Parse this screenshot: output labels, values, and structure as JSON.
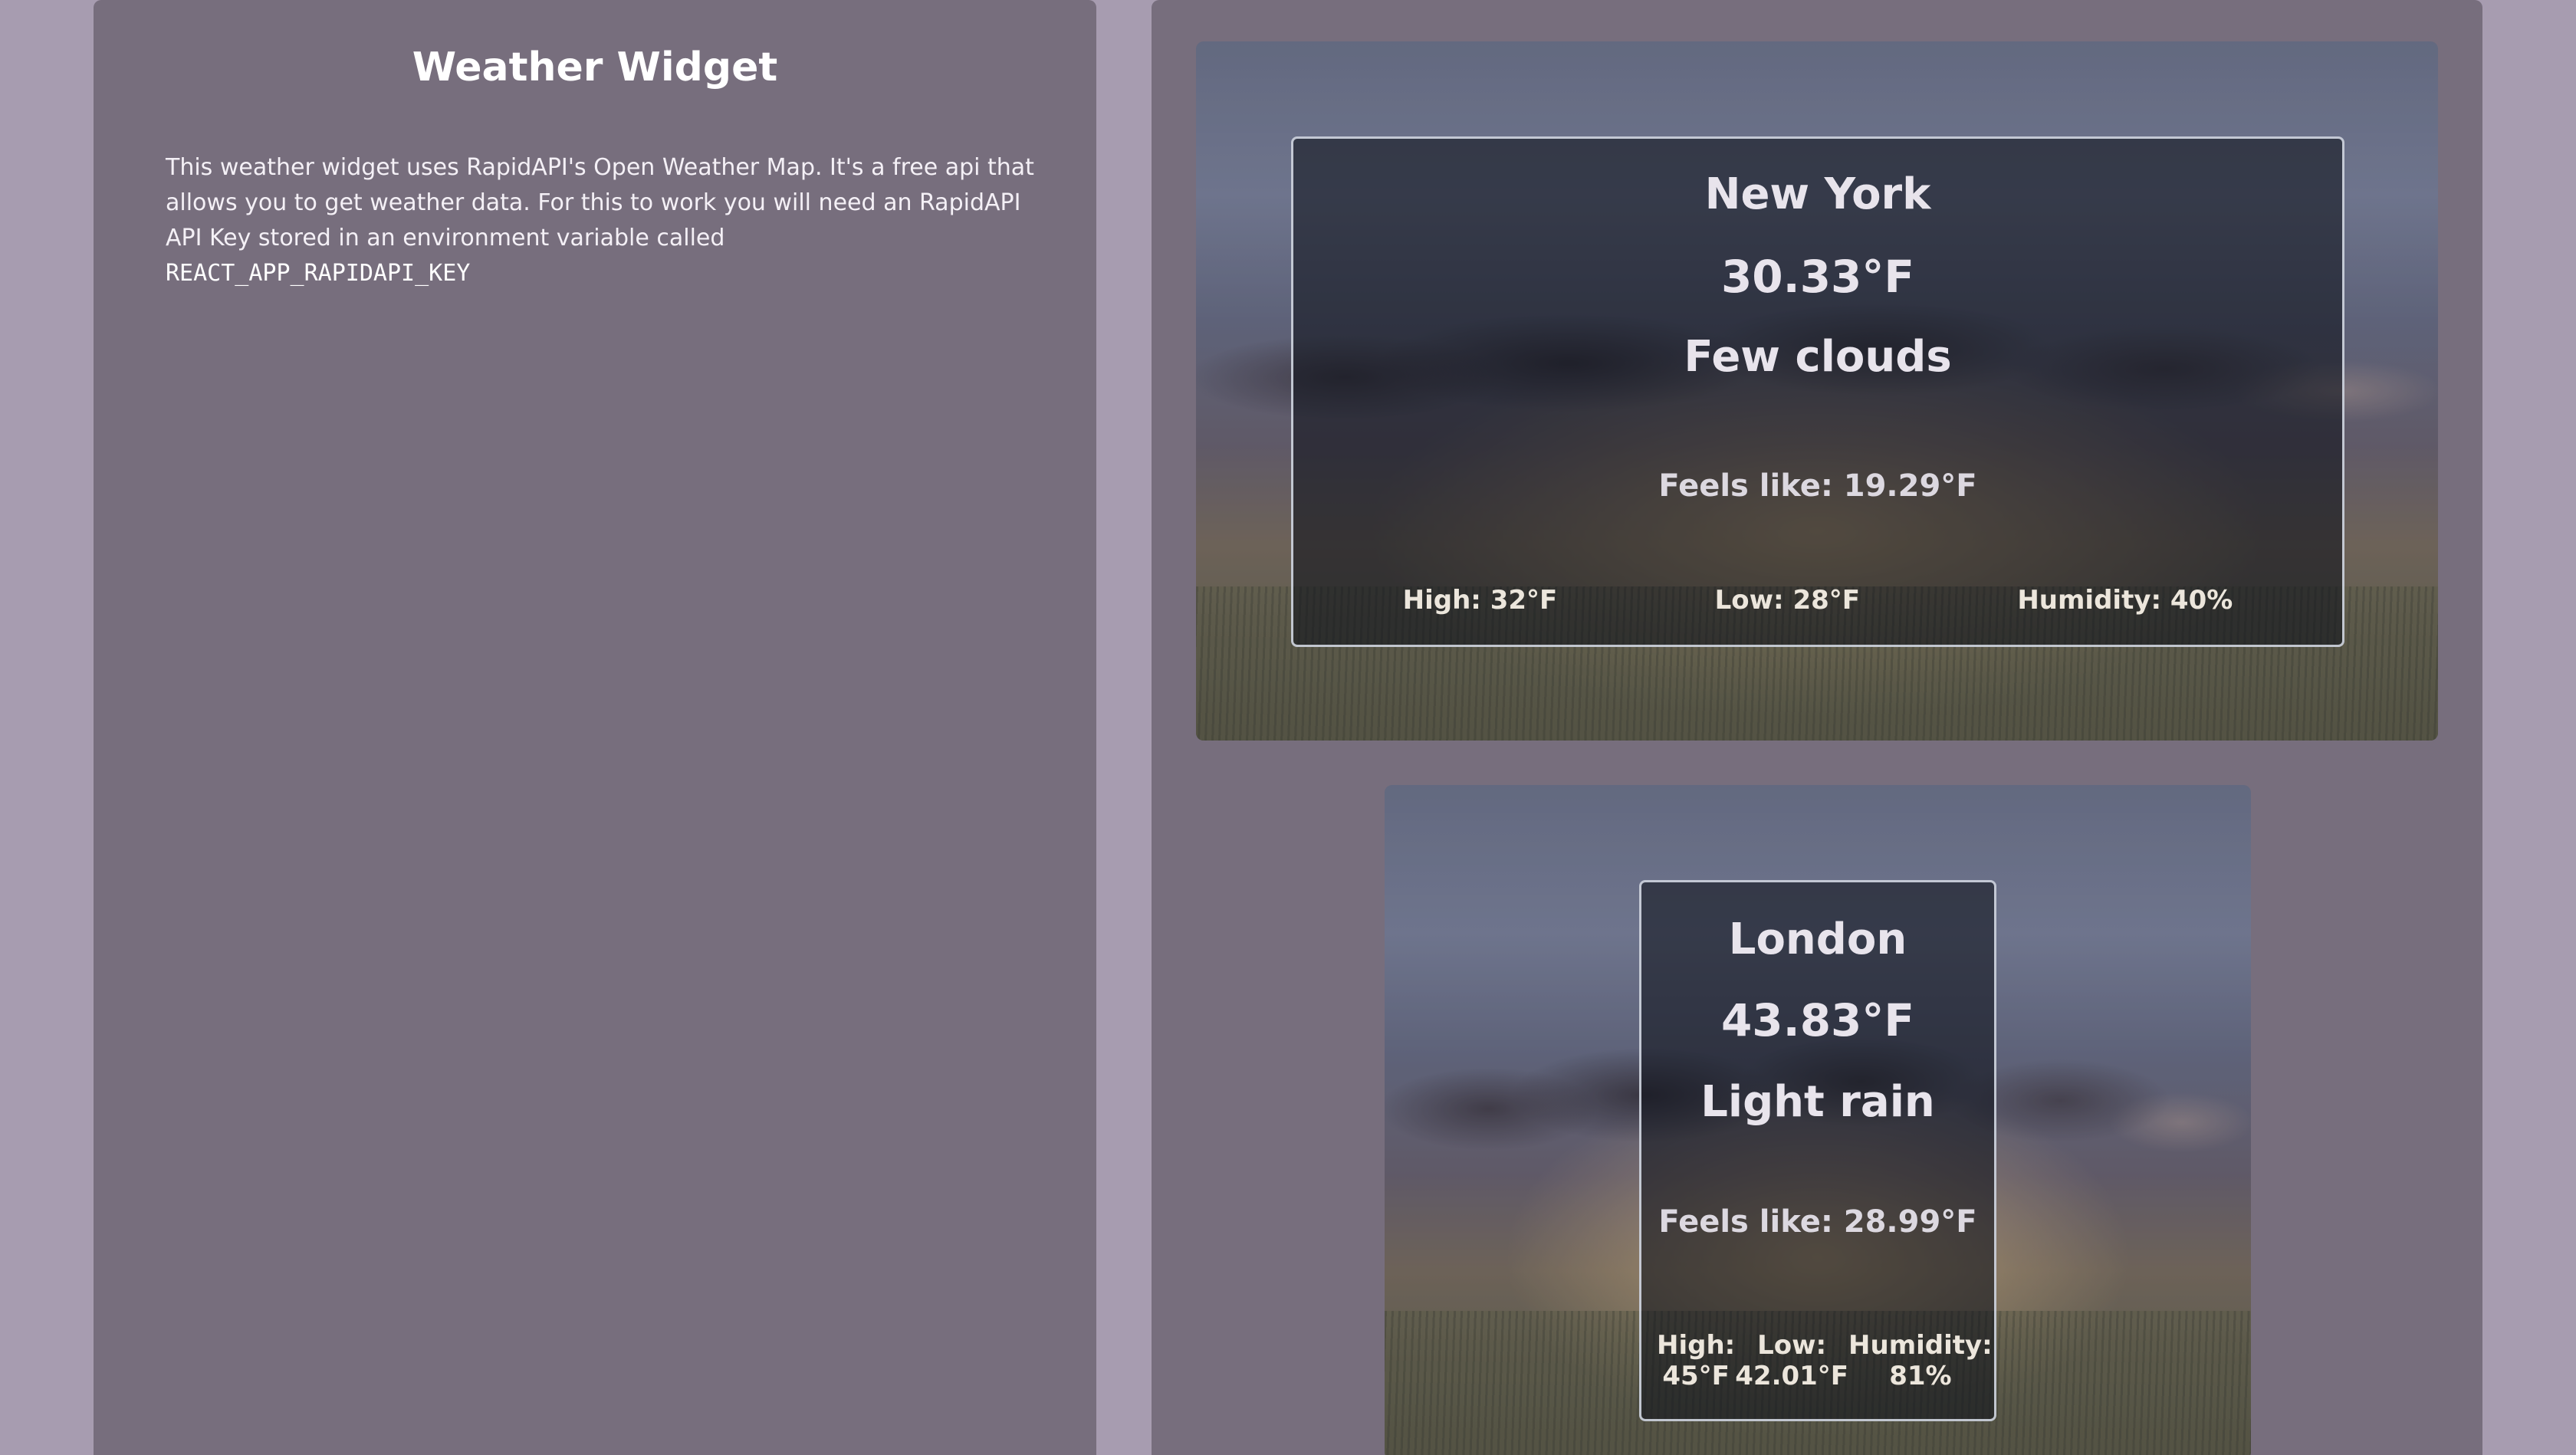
{
  "info_panel": {
    "title": "Weather Widget",
    "description": "This weather widget uses RapidAPI's Open Weather Map. It's a free api that allows you to get weather data. For this to work you will need an RapidAPI API Key stored in an environment variable called",
    "env_var": "REACT_APP_RAPIDAPI_KEY"
  },
  "weather_cards": [
    {
      "city": "New York",
      "temperature": "30.33°F",
      "condition": "Few clouds",
      "feels_like": "Feels like: 19.29°F",
      "high": "High: 32°F",
      "low": "Low: 28°F",
      "humidity": "Humidity: 40%"
    },
    {
      "city": "London",
      "temperature": "43.83°F",
      "condition": "Light rain",
      "feels_like": "Feels like: 28.99°F",
      "high_label": "High:",
      "high_value": "45°F",
      "low_label": "Low:",
      "low_value": "42.01°F",
      "humidity_label": "Humidity:",
      "humidity_value": "81%"
    }
  ],
  "colors": {
    "page_background": "#a79cb0",
    "panel_background": "#776e7d",
    "card_border": "#dce2ec",
    "text": "#ffffff"
  }
}
